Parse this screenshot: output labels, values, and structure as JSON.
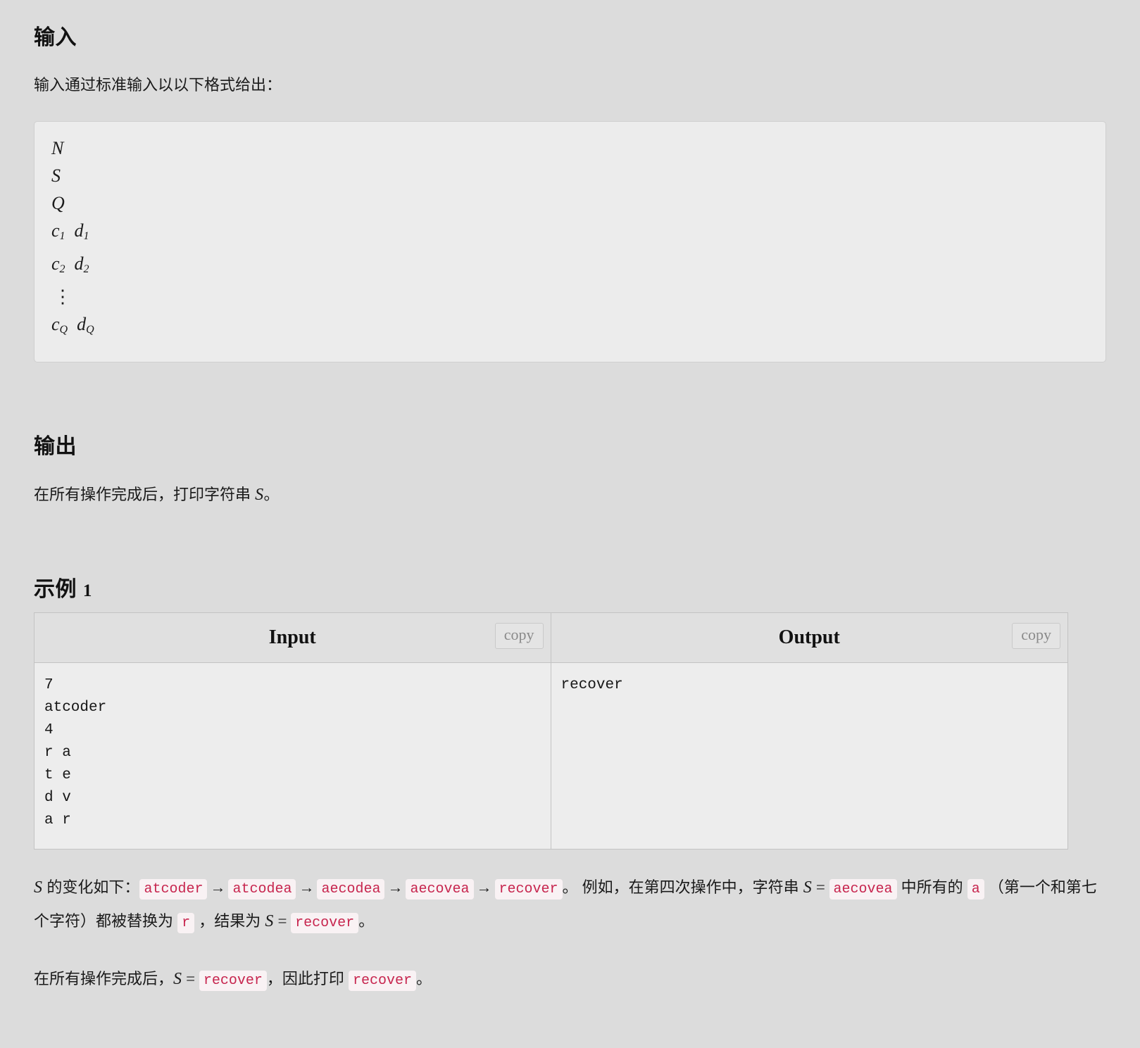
{
  "input_section": {
    "heading": "输入",
    "description": "输入通过标准输入以以下格式给出：",
    "format_lines": [
      {
        "text": "N"
      },
      {
        "text": "S"
      },
      {
        "text": "Q"
      },
      {
        "base": "c",
        "sub": "1",
        "base2": "d",
        "sub2": "1"
      },
      {
        "base": "c",
        "sub": "2",
        "base2": "d",
        "sub2": "2"
      },
      {
        "text": "⋮"
      },
      {
        "base": "c",
        "sub": "Q",
        "base2": "d",
        "sub2": "Q"
      }
    ]
  },
  "output_section": {
    "heading": "输出",
    "description_before": "在所有操作完成后，打印字符串 ",
    "description_var": "S",
    "description_after": "。"
  },
  "sample_section": {
    "heading_text": "示例",
    "heading_number": "1",
    "input_header": "Input",
    "output_header": "Output",
    "copy_label": "copy",
    "input_text": "7\natcoder\n4\nr a\nt e\nd v\na r",
    "output_text": "recover"
  },
  "explanation": {
    "line1_prefix_var": "S",
    "line1_prefix": " 的变化如下：",
    "steps": [
      "atcoder",
      "atcodea",
      "aecodea",
      "aecovea",
      "recover"
    ],
    "arrow": "→",
    "line1_mid": "。 例如，在第四次操作中，字符串 ",
    "line1_var": "S",
    "line1_eq": " = ",
    "line2_string": "aecovea",
    "line2_mid1": " 中所有的 ",
    "line2_char_a": "a",
    "line2_mid2": " （第一个和第七个字符）都被替换为 ",
    "line2_char_r": "r",
    "line2_mid3": " ，结果为 ",
    "line2_var": "S",
    "line2_eq": " = ",
    "line2_result": "recover",
    "line2_end": "。",
    "line3_prefix": "在所有操作完成后，",
    "line3_var": "S",
    "line3_eq": " = ",
    "line3_value": "recover",
    "line3_mid": "，因此打印 ",
    "line3_value2": "recover",
    "line3_end": "。"
  },
  "colors": {
    "page_bg": "#dcdcdc",
    "code_bg": "#ececec",
    "highlight_bg": "#f9f2f4",
    "highlight_fg": "#c7254e"
  }
}
